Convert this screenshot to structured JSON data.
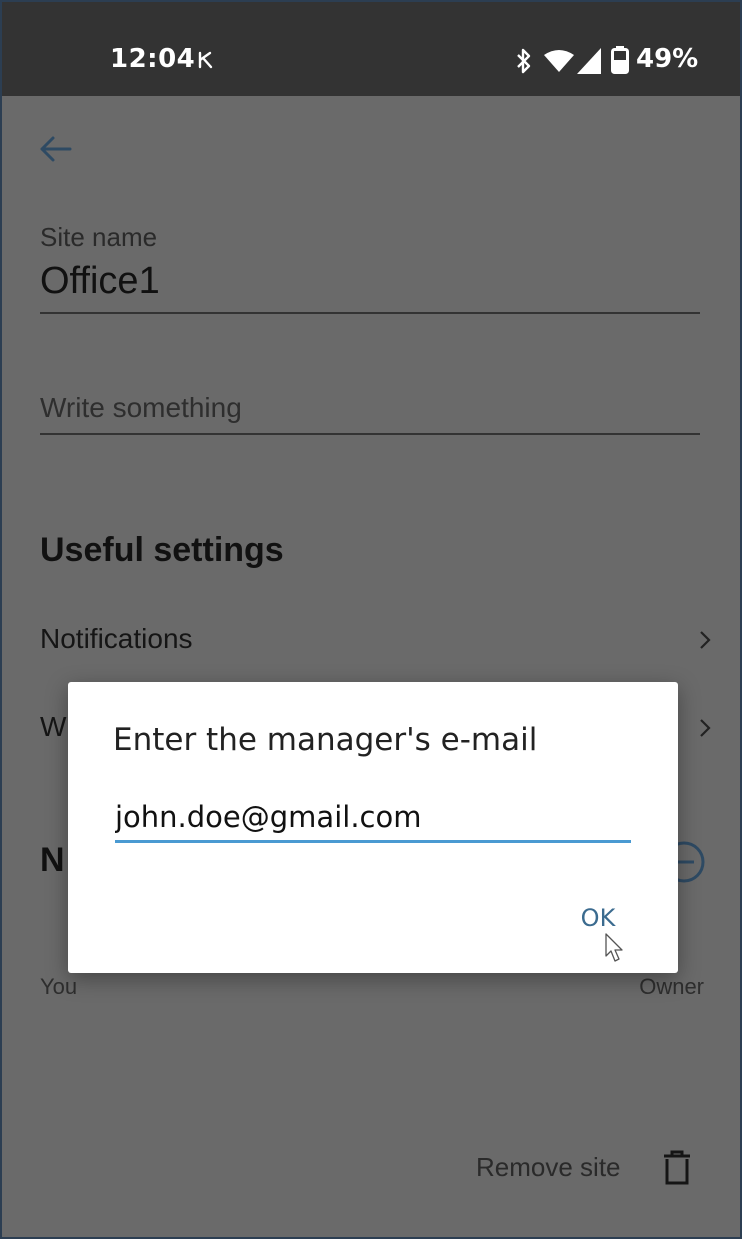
{
  "status_bar": {
    "time": "12:04",
    "battery": "49%",
    "icons": [
      "k-keyboard-icon",
      "bluetooth-icon",
      "wifi-icon",
      "cellular-signal-icon",
      "battery-icon"
    ]
  },
  "site_form": {
    "name_label": "Site name",
    "name_value": "Office1",
    "description_placeholder": "Write something"
  },
  "settings": {
    "heading": "Useful settings",
    "items": [
      {
        "label": "Notifications"
      },
      {
        "label": "W"
      }
    ]
  },
  "members": {
    "heading": "N",
    "rows": [
      {
        "name": "You",
        "role": "Owner"
      }
    ]
  },
  "remove_site_label": "Remove site",
  "dialog": {
    "title": "Enter the manager's e-mail",
    "email_value": "john.doe@gmail.com",
    "ok_label": "OK"
  },
  "colors": {
    "accent": "#4a9ad2",
    "ok_text": "#3b6b8f",
    "scrim_background": "#6a6a6a",
    "status_bar": "#333333"
  }
}
